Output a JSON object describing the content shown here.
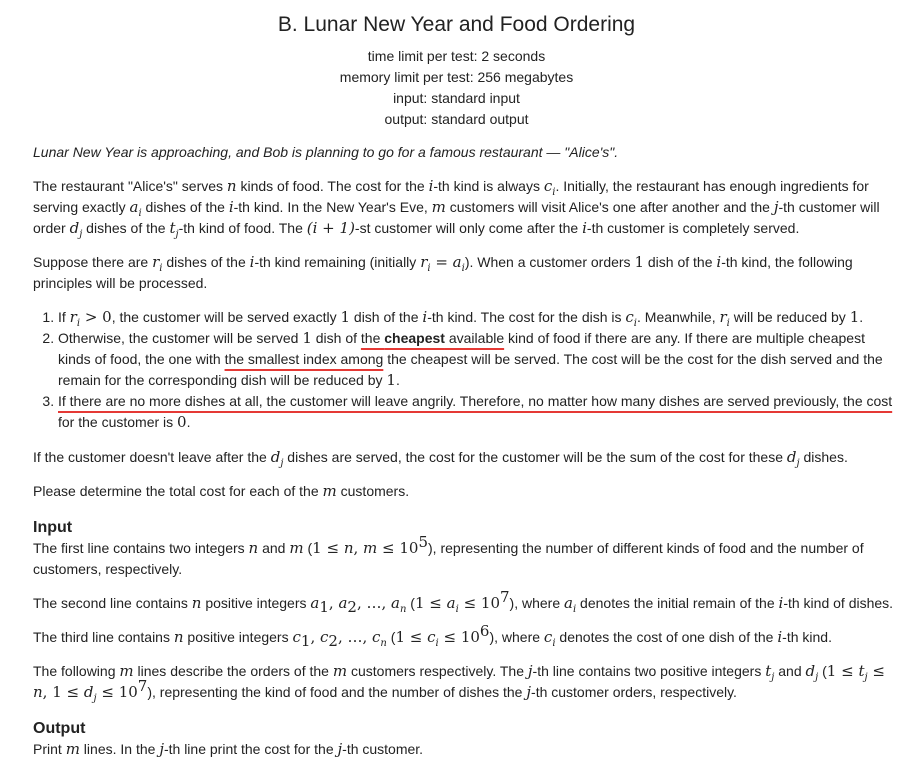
{
  "header": {
    "title": "B. Lunar New Year and Food Ordering",
    "time_limit": "time limit per test: 2 seconds",
    "memory_limit": "memory limit per test: 256 megabytes",
    "input": "input: standard input",
    "output": "output: standard output"
  },
  "legend": "Lunar New Year is approaching, and Bob is planning to go for a famous restaurant — \"Alice's\".",
  "para1": {
    "t1": "The restaurant \"Alice's\" serves ",
    "t2": " kinds of food. The cost for the ",
    "t3": "-th kind is always ",
    "t4": ". Initially, the restaurant has enough ingredients for serving exactly ",
    "t5": " dishes of the ",
    "t6": "-th kind. In the New Year's Eve, ",
    "t7": " customers will visit Alice's one after another and the ",
    "t8": "-th customer will order ",
    "t9": " dishes of the ",
    "t10": "-th kind of food. The ",
    "t11": "-st customer will only come after the ",
    "t12": "-th customer is completely served."
  },
  "para2": {
    "t1": "Suppose there are ",
    "t2": " dishes of the ",
    "t3": "-th kind remaining (initially ",
    "t4": "). When a customer orders ",
    "t5": " dish of the ",
    "t6": "-th kind, the following principles will be processed."
  },
  "list": {
    "item1": {
      "t1": "If ",
      "t2": ", the customer will be served exactly ",
      "t3": " dish of the ",
      "t4": "-th kind. The cost for the dish is ",
      "t5": ". Meanwhile, ",
      "t6": " will be reduced by ",
      "t7": "."
    },
    "item2": {
      "t1": "Otherwise, the customer will be served ",
      "t2": " dish of ",
      "t3": "the ",
      "t4": "cheapest",
      "t5": " available",
      "t6": " kind of food if there are any. If there are multiple cheapest kinds of food, the one with ",
      "t7": "the smallest index among",
      "t8": " the cheapest will be served. The cost will be the cost for the dish served and the remain for the corresponding dish will be reduced by ",
      "t9": "."
    },
    "item3": {
      "t1": "If there are no more dishes at all, the customer will leave angrily. Therefore, no matter how many dishes are served previously, the cost",
      "t2": " for the customer is ",
      "t3": "."
    }
  },
  "para3": {
    "t1": "If the customer doesn't leave after the ",
    "t2": " dishes are served, the cost for the customer will be the sum of the cost for these ",
    "t3": " dishes."
  },
  "para4": {
    "t1": "Please determine the total cost for each of the ",
    "t2": " customers."
  },
  "input_section": {
    "title": "Input",
    "p1": {
      "t1": "The first line contains two integers ",
      "t2": " and ",
      "t3": " (",
      "t4": "), representing the number of different kinds of food and the number of customers, respectively."
    },
    "p2": {
      "t1": "The second line contains ",
      "t2": " positive integers ",
      "t3": " (",
      "t4": "), where ",
      "t5": " denotes the initial remain of the ",
      "t6": "-th kind of dishes."
    },
    "p3": {
      "t1": "The third line contains ",
      "t2": " positive integers ",
      "t3": " (",
      "t4": "), where ",
      "t5": " denotes the cost of one dish of the ",
      "t6": "-th kind."
    },
    "p4": {
      "t1": "The following ",
      "t2": " lines describe the orders of the ",
      "t3": " customers respectively. The ",
      "t4": "-th line contains two positive integers ",
      "t5": " and ",
      "t6": " (",
      "t7": "), representing the kind of food and the number of dishes the ",
      "t8": "-th customer orders, respectively."
    }
  },
  "output_section": {
    "title": "Output",
    "p1": {
      "t1": "Print ",
      "t2": " lines. In the ",
      "t3": "-th line print the cost for the ",
      "t4": "-th customer."
    }
  },
  "math": {
    "n": "n",
    "m": "m",
    "i": "i",
    "j": "j",
    "c": "c",
    "a": "a",
    "d": "d",
    "t": "t",
    "r": "r",
    "sub_i": "i",
    "sub_j": "j",
    "sub_n": "n",
    "one": "1",
    "two": "2",
    "zero": "0",
    "i_plus_1": "(i + 1)",
    "r_eq_a_eq": " = ",
    "gt_zero": " > 0",
    "leq": " ≤ ",
    "comma": ", ",
    "ellipsis": ", …, ",
    "ten": "10",
    "exp5": "5",
    "exp7": "7",
    "exp6": "6"
  },
  "colors": {
    "underline": "#e53935",
    "text": "#222222",
    "background": "#ffffff"
  }
}
